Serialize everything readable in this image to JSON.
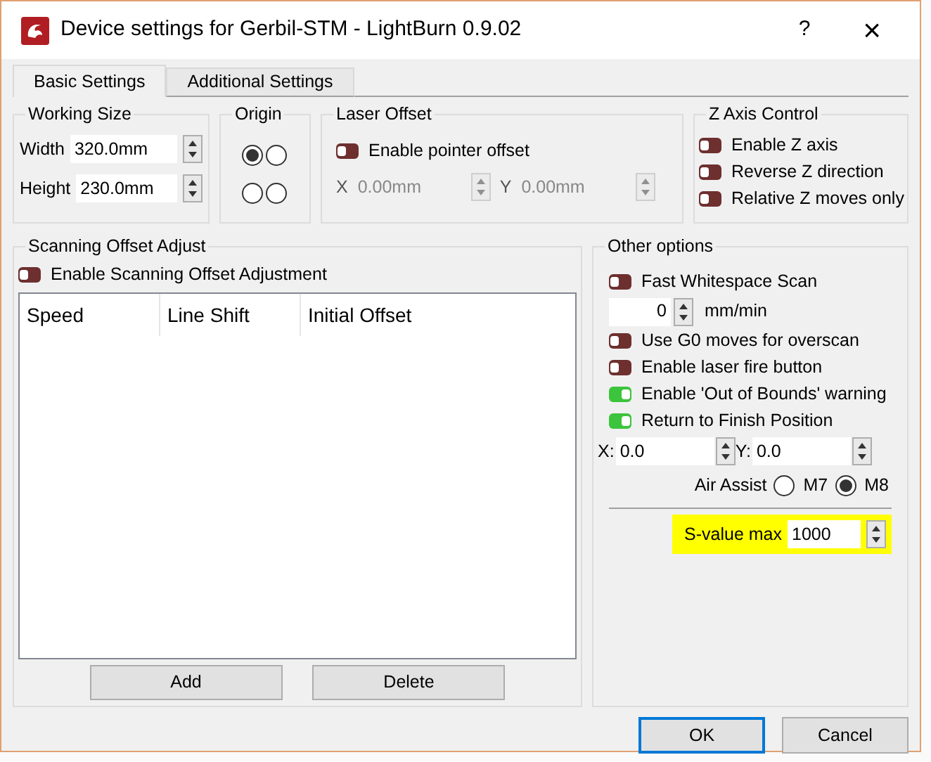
{
  "window": {
    "title": "Device settings for Gerbil-STM - LightBurn 0.9.02",
    "help": "?",
    "close": "×"
  },
  "tabs": [
    {
      "label": "Basic Settings",
      "selected": true
    },
    {
      "label": "Additional Settings",
      "selected": false
    }
  ],
  "working_size": {
    "title": "Working Size",
    "fields": [
      {
        "label": "Width",
        "value": "320.0mm"
      },
      {
        "label": "Height",
        "value": "230.0mm"
      }
    ]
  },
  "origin": {
    "title": "Origin",
    "options": [
      {
        "selected": true
      },
      {
        "selected": false
      },
      {
        "selected": false
      },
      {
        "selected": false
      }
    ]
  },
  "laser_offset": {
    "title": "Laser Offset",
    "toggle": {
      "label": "Enable pointer offset",
      "on": false
    },
    "fields": [
      {
        "label": "X",
        "value": "0.00mm",
        "disabled": true
      },
      {
        "label": "Y",
        "value": "0.00mm",
        "disabled": true
      }
    ]
  },
  "z_axis": {
    "title": "Z Axis Control",
    "toggles": [
      {
        "label": "Enable Z axis",
        "on": false
      },
      {
        "label": "Reverse Z direction",
        "on": false
      },
      {
        "label": "Relative Z moves only",
        "on": false
      }
    ]
  },
  "scanning": {
    "title": "Scanning Offset Adjust",
    "toggle": {
      "label": "Enable Scanning Offset Adjustment",
      "on": false
    },
    "columns": [
      "Speed",
      "Line Shift",
      "Initial Offset"
    ],
    "buttons": [
      "Add",
      "Delete"
    ]
  },
  "other_options": {
    "title": "Other options",
    "items": [
      {
        "kind": "toggle",
        "label": "Fast Whitespace Scan",
        "on": false
      },
      {
        "kind": "spin",
        "value": "0",
        "unit": "mm/min"
      },
      {
        "kind": "toggle",
        "label": "Use G0 moves for overscan",
        "on": false
      },
      {
        "kind": "toggle",
        "label": "Enable laser fire button",
        "on": false
      },
      {
        "kind": "toggle",
        "label": "Enable 'Out of Bounds' warning",
        "on": true
      },
      {
        "kind": "toggle",
        "label": "Return to Finish Position",
        "on": true
      },
      {
        "kind": "xy",
        "fields": [
          {
            "label": "X:",
            "value": "0.0"
          },
          {
            "label": "Y:",
            "value": "0.0"
          }
        ]
      },
      {
        "kind": "radio",
        "label": "Air Assist",
        "options": [
          {
            "label": "M7",
            "selected": false
          },
          {
            "label": "M8",
            "selected": true
          }
        ]
      },
      {
        "kind": "divider"
      },
      {
        "kind": "labeled_spin",
        "label": "S-value max",
        "value": "1000",
        "highlighted": true
      }
    ]
  },
  "buttons": [
    {
      "label": "OK",
      "default": true
    },
    {
      "label": "Cancel",
      "default": false
    }
  ]
}
